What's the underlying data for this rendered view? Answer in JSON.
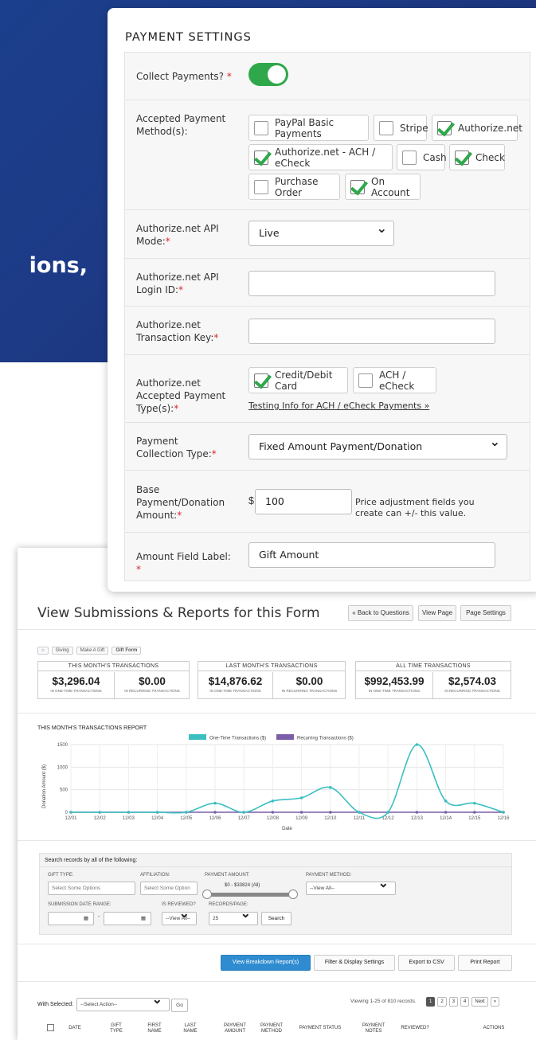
{
  "hero": {
    "text": "ions,"
  },
  "payment_settings": {
    "title": "PAYMENT SETTINGS",
    "collect_payments_label": "Collect Payments?",
    "accepted_methods_label": "Accepted Payment Method(s):",
    "methods": [
      {
        "label": "PayPal Basic Payments",
        "checked": false
      },
      {
        "label": "Stripe",
        "checked": false
      },
      {
        "label": "Authorize.net",
        "checked": true
      },
      {
        "label": "Authorize.net - ACH / eCheck",
        "checked": true
      },
      {
        "label": "Cash",
        "checked": false
      },
      {
        "label": "Check",
        "checked": true
      },
      {
        "label": "Purchase Order",
        "checked": false
      },
      {
        "label": "On Account",
        "checked": true
      }
    ],
    "api_mode_label": "Authorize.net API Mode:",
    "api_mode_value": "Live",
    "login_id_label": "Authorize.net API Login ID:",
    "login_id_value": "",
    "tx_key_label": "Authorize.net Transaction Key:",
    "tx_key_value": "",
    "accepted_types_label": "Authorize.net Accepted Payment Type(s):",
    "types": [
      {
        "label": "Credit/Debit Card",
        "checked": true
      },
      {
        "label": "ACH / eCheck",
        "checked": false
      }
    ],
    "testing_link": "Testing Info for ACH / eCheck Payments »",
    "collection_type_label": "Payment Collection Type:",
    "collection_type_value": "Fixed Amount Payment/Donation",
    "base_amount_label": "Base Payment/Donation Amount:",
    "currency": "$",
    "base_amount_value": "100",
    "base_amount_hint": "Price adjustment fields you create can +/- this value.",
    "amount_field_label": "Amount Field Label:",
    "amount_field_value": "Gift Amount"
  },
  "submissions": {
    "title": "View Submissions & Reports for this Form",
    "buttons": {
      "back": "« Back to Questions",
      "view_page": "View Page",
      "page_settings": "Page Settings"
    },
    "breadcrumbs": [
      "Giving",
      "Make A Gift",
      "Gift Form"
    ],
    "stats": [
      {
        "header": "THIS MONTH'S TRANSACTIONS",
        "one_time": "$3,296.04",
        "recurring": "$0.00"
      },
      {
        "header": "LAST MONTH'S TRANSACTIONS",
        "one_time": "$14,876.62",
        "recurring": "$0.00"
      },
      {
        "header": "ALL TIME TRANSACTIONS",
        "one_time": "$992,453.99",
        "recurring": "$2,574.03"
      }
    ],
    "stat_sub_one": "IN ONE-TIME TRANSACTIONS",
    "stat_sub_rec": "IN RECURRING TRANSACTIONS",
    "report_title": "THIS MONTH'S TRANSACTIONS REPORT",
    "search": {
      "heading": "Search records by all of the following:",
      "gift_type_label": "GIFT TYPE:",
      "gift_type_placeholder": "Select Some Options",
      "affiliation_label": "AFFILIATION:",
      "affiliation_placeholder": "Select Some Option",
      "payment_amount_label": "PAYMENT AMOUNT:",
      "payment_amount_range": "$0 - $33824 (All)",
      "payment_method_label": "PAYMENT METHOD:",
      "payment_method_value": "--View All--",
      "date_range_label": "SUBMISSION DATE RANGE:",
      "date_sep": "-",
      "reviewed_label": "IS REVIEWED?",
      "reviewed_value": "--View All--",
      "records_label": "RECORDS/PAGE:",
      "records_value": "25",
      "search_button": "Search"
    },
    "action_buttons": {
      "breakdown": "View Breakdown Report(s)",
      "filter": "Filter & Display Settings",
      "export": "Export to CSV",
      "print": "Print Report"
    },
    "with_selected_label": "With Selected:",
    "select_action": "--Select Action--",
    "go": "Go",
    "viewing": "Viewing 1-25 of 810 records.",
    "pages": [
      "1",
      "2",
      "3",
      "4",
      "Next",
      "»"
    ],
    "columns": [
      "DATE",
      "GIFT TYPE",
      "FIRST NAME",
      "LAST NAME",
      "PAYMENT AMOUNT",
      "PAYMENT METHOD",
      "PAYMENT STATUS",
      "PAYMENT NOTES",
      "REVIEWED?",
      "ACTIONS"
    ]
  },
  "chart_data": {
    "type": "line",
    "title": "THIS MONTH'S TRANSACTIONS REPORT",
    "xlabel": "Date",
    "ylabel": "Donation Amount ($)",
    "ylim": [
      0,
      1500
    ],
    "yticks": [
      "0",
      "500",
      "1000",
      "1500"
    ],
    "categories": [
      "12/01",
      "12/02",
      "12/03",
      "12/04",
      "12/05",
      "12/06",
      "12/07",
      "12/08",
      "12/09",
      "12/10",
      "12/11",
      "12/12",
      "12/13",
      "12/14",
      "12/15",
      "12/16"
    ],
    "series": [
      {
        "name": "One-Time Transactions ($)",
        "color": "#3cbfc0",
        "values": [
          0,
          0,
          0,
          0,
          0,
          200,
          0,
          250,
          320,
          550,
          0,
          0,
          1500,
          250,
          200,
          0
        ]
      },
      {
        "name": "Recurring Transactions ($)",
        "color": "#7b5ea8",
        "values": [
          0,
          0,
          0,
          0,
          0,
          0,
          0,
          0,
          0,
          0,
          0,
          0,
          0,
          0,
          0,
          0
        ]
      }
    ],
    "legend": "top",
    "grid": true
  }
}
